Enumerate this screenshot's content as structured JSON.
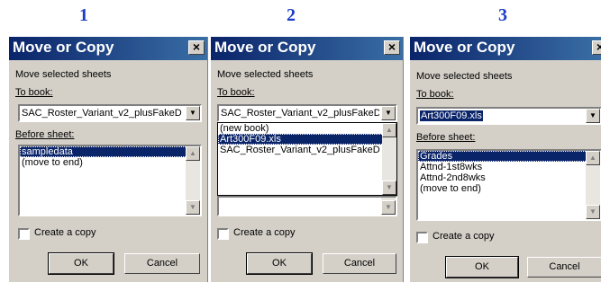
{
  "steps": [
    "1",
    "2",
    "3"
  ],
  "dialogs": [
    {
      "title": "Move or Copy",
      "close_icon": "×",
      "move_label": "Move selected sheets",
      "to_book_label": "To book:",
      "to_book_value": "SAC_Roster_Variant_v2_plusFakeD",
      "before_sheet_label": "Before sheet:",
      "sheets": [
        "sampledata",
        "(move to end)"
      ],
      "selected_sheet": "sampledata",
      "create_copy_label": "Create a copy",
      "ok_label": "OK",
      "cancel_label": "Cancel"
    },
    {
      "title": "Move or Copy",
      "close_icon": "×",
      "move_label": "Move selected sheets",
      "to_book_label": "To book:",
      "to_book_value": "SAC_Roster_Variant_v2_plusFakeD",
      "dropdown_options": [
        "(new book)",
        "Art300F09.xls",
        "SAC_Roster_Variant_v2_plusFakeD"
      ],
      "highlighted_option": "Art300F09.xls",
      "create_copy_label": "Create a copy",
      "ok_label": "OK",
      "cancel_label": "Cancel"
    },
    {
      "title": "Move or Copy",
      "close_icon": "×",
      "move_label": "Move selected sheets",
      "to_book_label": "To book:",
      "to_book_value": "Art300F09.xls",
      "before_sheet_label": "Before sheet:",
      "sheets": [
        "Grades",
        "Attnd-1st8wks",
        "Attnd-2nd8wks",
        "(move to end)"
      ],
      "selected_sheet": "Grades",
      "create_copy_label": "Create a copy",
      "ok_label": "OK",
      "cancel_label": "Cancel"
    }
  ]
}
